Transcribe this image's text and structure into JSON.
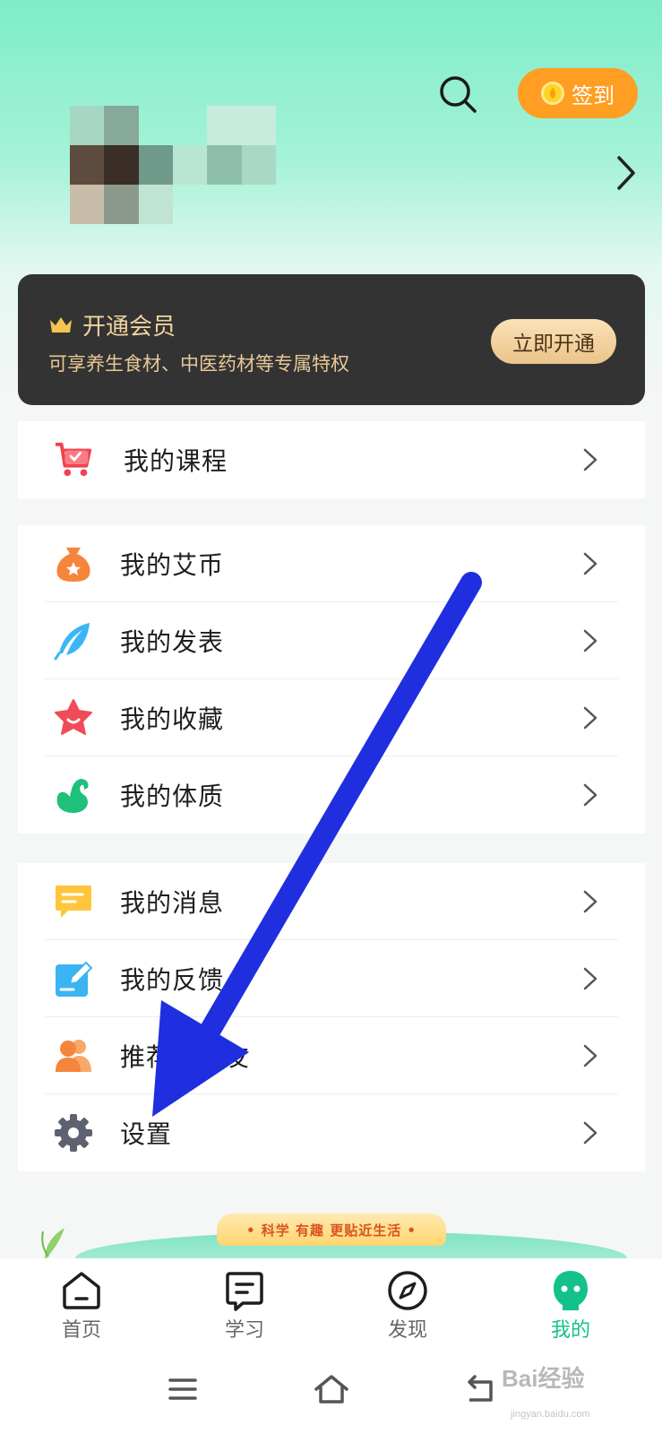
{
  "header": {
    "checkin_label": "签到",
    "search_icon": "search-icon",
    "profile_chevron": "chevron-right-icon"
  },
  "vip": {
    "title": "开通会员",
    "subtitle": "可享养生食材、中医药材等专属特权",
    "button": "立即开通",
    "accent": "#f2d2a0"
  },
  "courses": {
    "label": "我的课程"
  },
  "group1": [
    {
      "label": "我的艾币",
      "icon": "coin-bag-icon"
    },
    {
      "label": "我的发表",
      "icon": "feather-icon"
    },
    {
      "label": "我的收藏",
      "icon": "star-icon"
    },
    {
      "label": "我的体质",
      "icon": "muscle-icon"
    }
  ],
  "group2": [
    {
      "label": "我的消息",
      "icon": "message-icon"
    },
    {
      "label": "我的反馈",
      "icon": "feedback-icon"
    },
    {
      "label": "推荐给朋友",
      "icon": "users-icon"
    },
    {
      "label": "设置",
      "icon": "gear-icon"
    }
  ],
  "banner": {
    "slogan": "• 科学  有趣  更贴近生活 •"
  },
  "tabs": [
    {
      "label": "首页",
      "icon": "home-icon"
    },
    {
      "label": "学习",
      "icon": "study-icon"
    },
    {
      "label": "发现",
      "icon": "compass-icon"
    },
    {
      "label": "我的",
      "icon": "profile-icon",
      "active": true
    }
  ],
  "watermark": {
    "text": "Bai经验",
    "sub": "jingyan.baidu.com"
  },
  "colors": {
    "brand_green": "#12c28a",
    "checkin_orange": "#ff9e22",
    "arrow_blue": "#1f2fe0"
  }
}
